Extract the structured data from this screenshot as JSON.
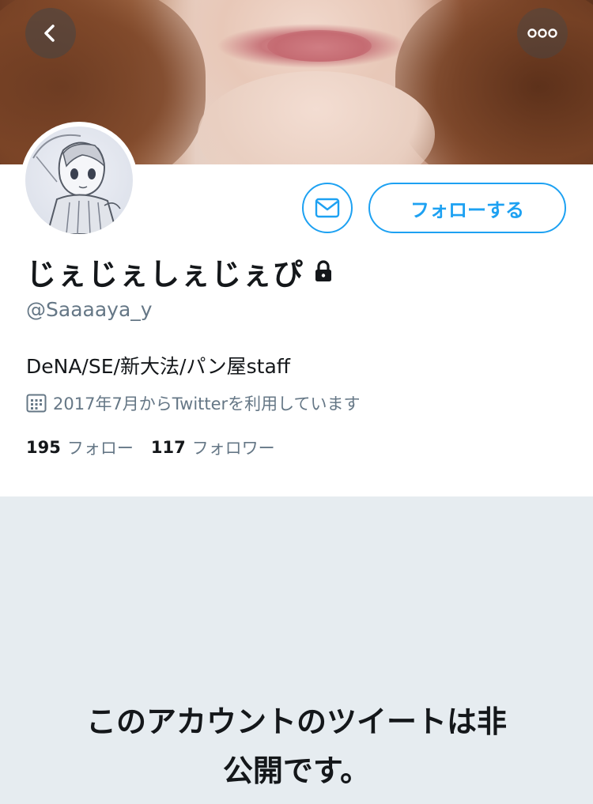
{
  "profile": {
    "display_name": "じぇじぇしぇじぇぴ",
    "handle": "@Saaaaya_y",
    "bio": "DeNA/SE/新大法/パン屋staff",
    "joined": "2017年7月からTwitterを利用しています",
    "protected": true
  },
  "actions": {
    "follow_label": "フォローする",
    "message_icon": "envelope-icon",
    "back_icon": "chevron-left-icon",
    "more_icon": "more-dots-icon"
  },
  "stats": {
    "following_count": "195",
    "following_label": "フォロー",
    "followers_count": "117",
    "followers_label": "フォロワー"
  },
  "private_notice": {
    "line1": "このアカウントのツイートは非",
    "line2": "公開です。"
  },
  "colors": {
    "accent": "#1da1f2",
    "secondary_text": "#657786",
    "primary_text": "#14171a",
    "section_bg": "#e6ecf0"
  }
}
